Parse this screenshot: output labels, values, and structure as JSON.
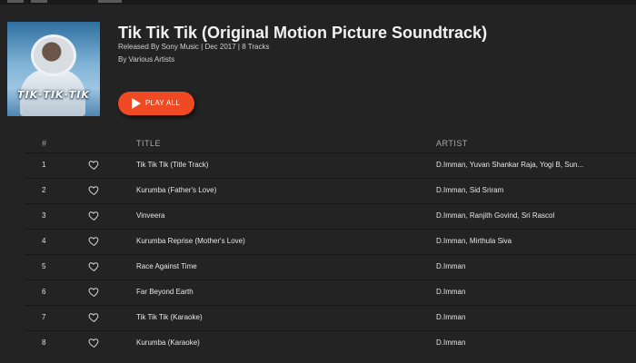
{
  "album": {
    "art_title": "TIK·TIK·TIK",
    "title": "Tik Tik Tik (Original Motion Picture Soundtrack)",
    "meta_line1": "Released By Sony Music | Dec 2017 | 8 Tracks",
    "meta_line2": "By Various Artists"
  },
  "actions": {
    "play_all_label": "PLAY ALL",
    "play_icon": "play-icon"
  },
  "table": {
    "headers": {
      "number": "#",
      "title": "TITLE",
      "artist": "ARTIST"
    },
    "heart_icon": "heart-icon",
    "rows": [
      {
        "number": "1",
        "title": "Tik Tik Tik (Title Track)",
        "artist": "D.Imman, Yuvan Shankar Raja, Yogi B, Sun..."
      },
      {
        "number": "2",
        "title": "Kurumba (Father's Love)",
        "artist": "D.Imman, Sid Sriram"
      },
      {
        "number": "3",
        "title": "Vinveera",
        "artist": "D.Imman, Ranjith Govind, Sri Rascol"
      },
      {
        "number": "4",
        "title": "Kurumba Reprise (Mother's Love)",
        "artist": "D.Imman, Mirthula Siva"
      },
      {
        "number": "5",
        "title": "Race Against Time",
        "artist": "D.Imman"
      },
      {
        "number": "6",
        "title": "Far Beyond Earth",
        "artist": "D.Imman"
      },
      {
        "number": "7",
        "title": "Tik Tik Tik (Karaoke)",
        "artist": "D.Imman"
      },
      {
        "number": "8",
        "title": "Kurumba (Karaoke)",
        "artist": "D.Imman"
      }
    ]
  },
  "colors": {
    "background": "#232323",
    "accent": "#ef4a24",
    "text": "#e6e6e6",
    "muted": "#a8a8a8"
  }
}
